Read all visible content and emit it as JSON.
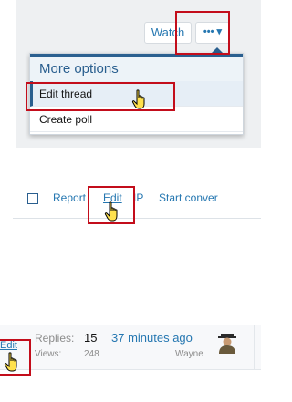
{
  "panel1": {
    "watch_label": "Watch",
    "more_label": "••• ▾",
    "menu_title": "More options",
    "menu_items": [
      "Edit thread",
      "Create poll"
    ]
  },
  "panel2": {
    "links": [
      "Report",
      "Edit",
      "IP",
      "Start conver"
    ]
  },
  "panel3": {
    "edit_label": "Edit",
    "replies_label": "Replies:",
    "replies_value": "15",
    "views_label": "Views:",
    "views_value": "248",
    "last_post_time": "37 minutes ago",
    "last_post_user": "Wayne"
  },
  "colors": {
    "highlight": "#c30d1b",
    "link": "#2577b1",
    "accent": "#2a5f8f"
  }
}
